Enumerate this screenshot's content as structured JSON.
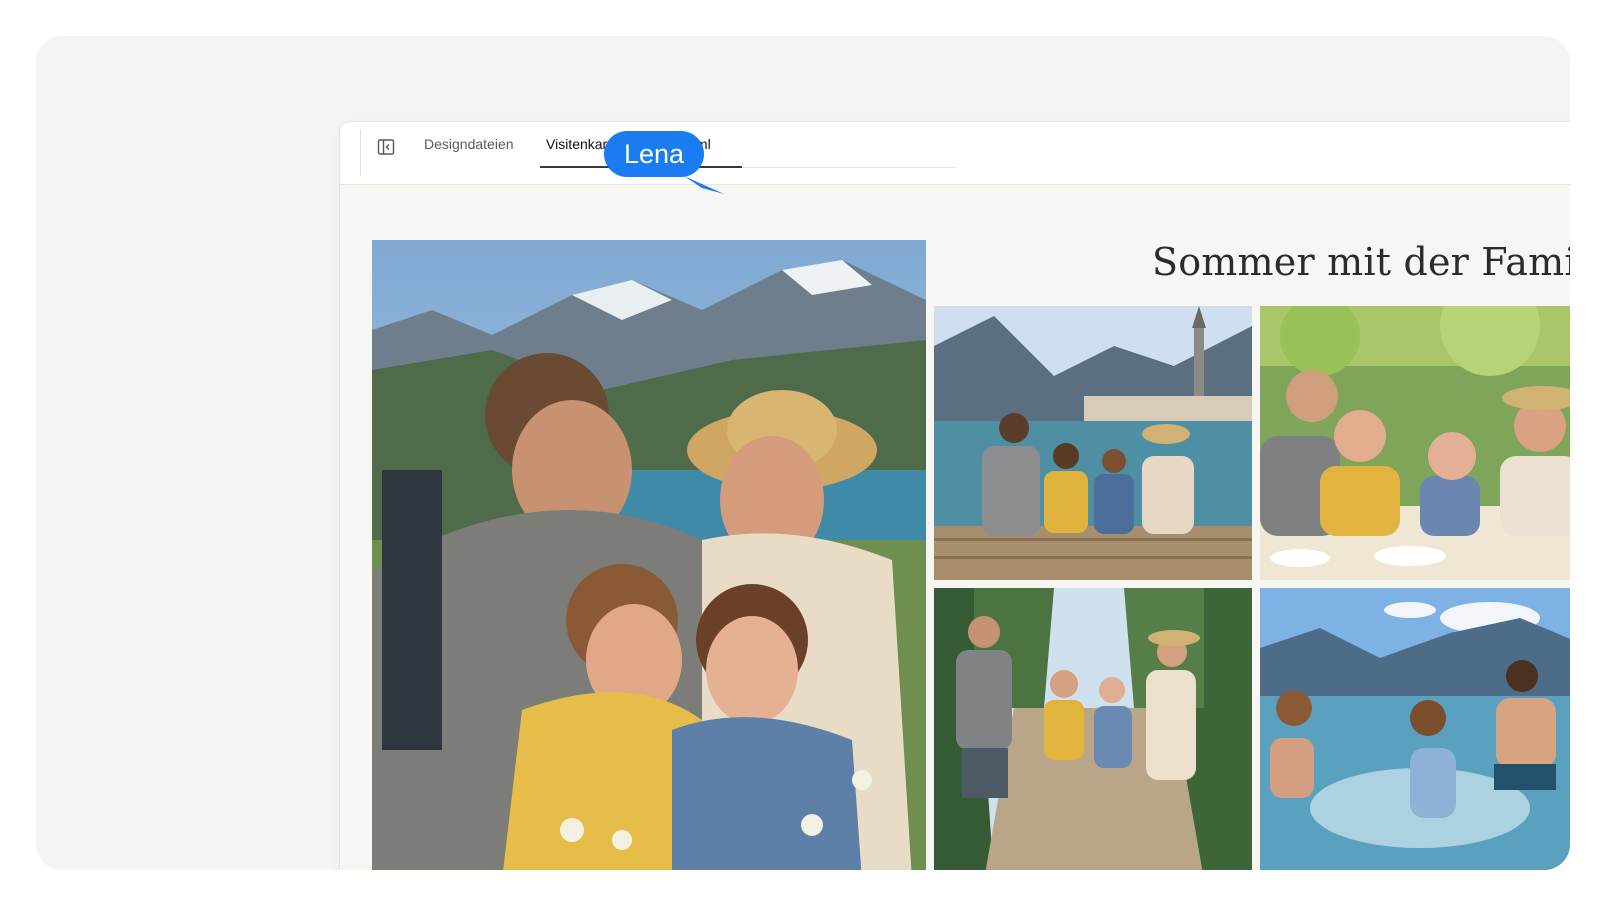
{
  "tabs": [
    {
      "label": "Designdateien",
      "active": false
    },
    {
      "label": "Visitenkarte Lichtblick.html",
      "active": true
    }
  ],
  "cursor": {
    "name": "Lena",
    "color": "#1a7cf0"
  },
  "page": {
    "headline": "Sommer mit der Familie"
  },
  "photos": [
    {
      "subject": "family-portrait-mountains"
    },
    {
      "subject": "family-on-lake-dock"
    },
    {
      "subject": "family-garden-lunch"
    },
    {
      "subject": "family-forest-walk"
    },
    {
      "subject": "children-splashing-lake"
    }
  ],
  "icons": {
    "panel_toggle": "sidebar-panel-icon"
  }
}
